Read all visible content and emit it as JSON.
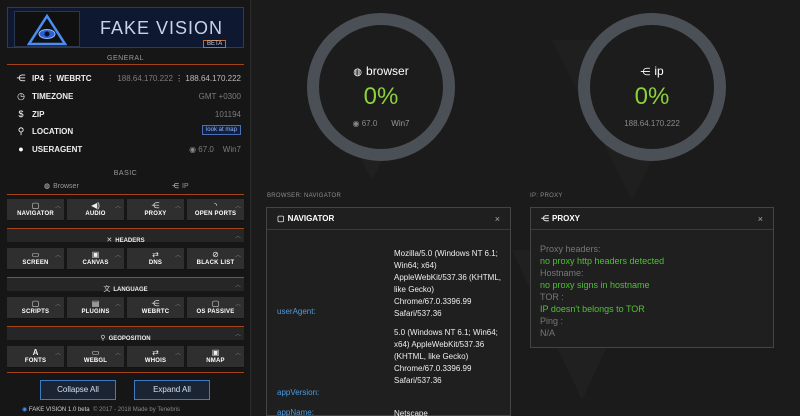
{
  "sidebar": {
    "logo": {
      "title": "FAKE VISION",
      "badge": "BETA"
    },
    "general_label": "GENERAL",
    "info": [
      {
        "icon": "share-icon",
        "label": "IP4 ⋮ WEBRTC",
        "value_a": "188.64.170.222",
        "value_b": "⋮ 188.64.170.222"
      },
      {
        "icon": "clock-icon",
        "label": "TIMEZONE",
        "value": "GMT +0300"
      },
      {
        "icon": "zip-icon",
        "label": "ZIP",
        "value": "101194"
      },
      {
        "icon": "location-pin-icon",
        "label": "LOCATION",
        "button": "look at map"
      },
      {
        "icon": "user-icon",
        "label": "USERAGENT",
        "value_a": "67.0",
        "value_b": "Win7"
      }
    ],
    "basic_label": "BASIC",
    "mode_browser": "Browser",
    "mode_ip": "IP",
    "rows": [
      [
        "NAVIGATOR",
        "AUDIO",
        "PROXY",
        "OPEN PORTS"
      ],
      [
        "SCREEN",
        "CANVAS",
        "DNS",
        "BLACK LIST"
      ],
      [
        "SCRIPTS",
        "PLUGINS",
        "WEBRTC",
        "OS PASSIVE"
      ],
      [
        "FONTS",
        "WEBGL",
        "WHOIS",
        "NMAP"
      ]
    ],
    "bars": [
      "HEADERS",
      "LANGUAGE",
      "GEOPOSITION"
    ],
    "collapse_label": "Collapse All",
    "expand_label": "Expand All",
    "footer_brand": "FAKE VISION 1.0 beta",
    "footer_text": "© 2017 - 2018 Made by Tenebris"
  },
  "gauges": {
    "browser": {
      "title": "browser",
      "percent": "0%",
      "version": "67.0",
      "os": "Win7"
    },
    "ip": {
      "title": "ip",
      "percent": "0%",
      "address": "188.64.170.222"
    }
  },
  "captions": {
    "browser": "BROWSER: NAVIGATOR",
    "ip": "IP: PROXY"
  },
  "navigator": {
    "title": "NAVIGATOR",
    "close": "×",
    "rows": [
      {
        "key": "userAgent:",
        "value": "Mozilla/5.0 (Windows NT 6.1; Win64; x64) AppleWebKit/537.36 (KHTML, like Gecko) Chrome/67.0.3396.99 Safari/537.36"
      },
      {
        "key": "appVersion:",
        "value": "5.0 (Windows NT 6.1; Win64; x64) AppleWebKit/537.36 (KHTML, like Gecko) Chrome/67.0.3396.99 Safari/537.36"
      },
      {
        "key": "appName:",
        "value": "Netscape"
      }
    ]
  },
  "proxy": {
    "title": "PROXY",
    "close": "×",
    "lines": [
      {
        "text": "Proxy headers:",
        "kind": "label"
      },
      {
        "text": "no proxy http headers detected",
        "kind": "ok"
      },
      {
        "text": "Hostname:",
        "kind": "label"
      },
      {
        "text": "no proxy signs in hostname",
        "kind": "ok"
      },
      {
        "text": "TOR :",
        "kind": "label"
      },
      {
        "text": "IP doesn't belongs to TOR",
        "kind": "ok"
      },
      {
        "text": "Ping :",
        "kind": "label"
      },
      {
        "text": "N/A",
        "kind": "label"
      }
    ]
  },
  "colors": {
    "accent": "#a44418",
    "ok": "#4ec234",
    "percent": "#8cd03a",
    "link": "#4d9be0"
  }
}
